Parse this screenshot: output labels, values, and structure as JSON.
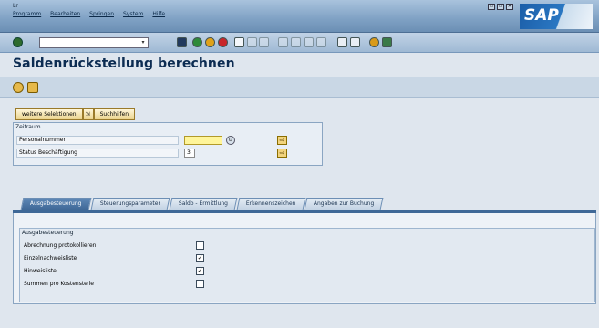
{
  "window": {
    "indicator": "Lr"
  },
  "menu": [
    "Programm",
    "Bearbeiten",
    "Springen",
    "System",
    "Hilfe"
  ],
  "window_controls": [
    "▭",
    "▭",
    "✕"
  ],
  "brand": {
    "logo_text": "SAP",
    "accent": "#1b5ea8"
  },
  "toolbar": {
    "command_field_value": "",
    "icons": [
      "enter-icon",
      "save-icon",
      "back-icon",
      "exit-icon",
      "cancel-icon",
      "print-icon",
      "find-icon",
      "find-next-icon",
      "first-page-icon",
      "previous-page-icon",
      "next-page-icon",
      "last-page-icon",
      "new-session-icon",
      "shortcut-icon",
      "help-icon",
      "layout-icon"
    ]
  },
  "page": {
    "title": "Saldenrückstellung berechnen"
  },
  "app_toolbar": {
    "icons": [
      "execute-icon",
      "variant-icon"
    ]
  },
  "selection_buttons": {
    "more_selections": "weitere Selektionen",
    "search_help": "Suchhilfen"
  },
  "selection_frame": {
    "title": "Zeitraum",
    "rows": [
      {
        "label": "Personalnummer",
        "value": ""
      },
      {
        "label": "Status Beschäftigung",
        "value": "3"
      }
    ]
  },
  "tabs": [
    {
      "label": "Ausgabesteuerung",
      "active": true
    },
    {
      "label": "Steuerungsparameter",
      "active": false
    },
    {
      "label": "Saldo - Ermittlung",
      "active": false
    },
    {
      "label": "Erkennenszeichen",
      "active": false
    },
    {
      "label": "Angaben zur Buchung",
      "active": false
    }
  ],
  "output_frame": {
    "title": "Ausgabesteuerung",
    "checkboxes": [
      {
        "label": "Abrechnung protokollieren",
        "checked": false,
        "mark": ""
      },
      {
        "label": "Einzelnachweisliste",
        "checked": true,
        "mark": "✓"
      },
      {
        "label": "Hinweisliste",
        "checked": true,
        "mark": "✓"
      },
      {
        "label": "Summen pro Kostenstelle",
        "checked": false,
        "mark": ""
      }
    ]
  }
}
